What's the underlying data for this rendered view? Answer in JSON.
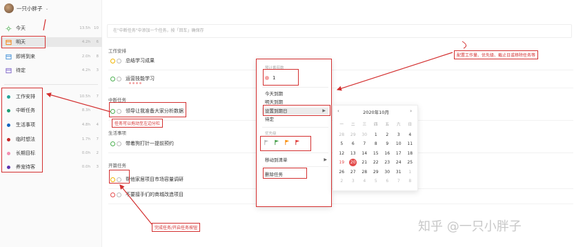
{
  "user": {
    "name": "一只小胖子",
    "caret": "⌄"
  },
  "sidebar": {
    "items": [
      {
        "label": "今天",
        "meta": "13.5h",
        "count": "10",
        "icon": "sun-icon",
        "color": "#4caf50"
      },
      {
        "label": "明天",
        "meta": "4.2h",
        "count": "6",
        "icon": "sunrise-icon",
        "color": "#f57c00"
      },
      {
        "label": "即将到来",
        "meta": "2.0h",
        "count": "8",
        "icon": "calendar-icon",
        "color": "#3f8fd8"
      },
      {
        "label": "待定",
        "meta": "4.2h",
        "count": "3",
        "icon": "calendar-icon",
        "color": "#7b61c9"
      }
    ],
    "lists": [
      {
        "label": "工作安排",
        "meta": "10.5h",
        "count": "7",
        "color": "#26a69a"
      },
      {
        "label": "中断任务",
        "meta": "8.3h",
        "count": "",
        "color": "#1e9e74"
      },
      {
        "label": "生活事项",
        "meta": "4.8h",
        "count": "4",
        "color": "#1565c0"
      },
      {
        "label": "临时想法",
        "meta": "1.7h",
        "count": "7",
        "color": "#c62828"
      },
      {
        "label": "长期目标",
        "meta": "0.0h",
        "count": "2",
        "color": "#f48fb1"
      },
      {
        "label": "养宠待客",
        "meta": "0.0h",
        "count": "3",
        "color": "#5e35b1"
      }
    ]
  },
  "main": {
    "add_placeholder": "在\"中断任务\"中添加一个任务，按「回车」确保存",
    "groups": [
      {
        "title": "工作安排",
        "tasks": [
          "总结学习成果",
          "运营技能学习"
        ]
      },
      {
        "title": "中断任务",
        "tasks": [
          "领导让我准备大家分析数据"
        ]
      },
      {
        "title": "生活事项",
        "tasks": [
          "带着狗打针一提前预约"
        ]
      },
      {
        "title": "开篇任务",
        "tasks": [
          "帮他家居项目市场容量调研",
          "不要接手们的商城改造项目"
        ]
      }
    ]
  },
  "menu": {
    "section_workload": "预计番茄数",
    "workload_value": "1",
    "items": [
      "今天到期",
      "明天到期",
      "设置到期日",
      "待定"
    ],
    "section_priority": "优先级",
    "move_to_list": "移动到清单",
    "delete_task": "删除任务",
    "arrow": "▶"
  },
  "calendar": {
    "title": "2020年10月",
    "prev": "‹",
    "next": "›",
    "weekdays": [
      "一",
      "二",
      "三",
      "四",
      "五",
      "六",
      "日"
    ],
    "days": [
      [
        "28",
        "29",
        "30",
        "1",
        "2",
        "3",
        "4"
      ],
      [
        "5",
        "6",
        "7",
        "8",
        "9",
        "10",
        "11"
      ],
      [
        "12",
        "13",
        "14",
        "15",
        "16",
        "17",
        "18"
      ],
      [
        "19",
        "20",
        "21",
        "22",
        "23",
        "24",
        "25"
      ],
      [
        "26",
        "27",
        "28",
        "29",
        "30",
        "31",
        "1"
      ],
      [
        "2",
        "3",
        "4",
        "5",
        "6",
        "7",
        "8"
      ]
    ],
    "today": "20"
  },
  "annotations": {
    "priority_note": "配置工作量、优先级、截止日或移除任务等",
    "drag_note": "任务可以拖动至左边分栏",
    "complete_note": "完成任务/开启任务按钮"
  },
  "watermark": "知乎 @一只小胖子"
}
